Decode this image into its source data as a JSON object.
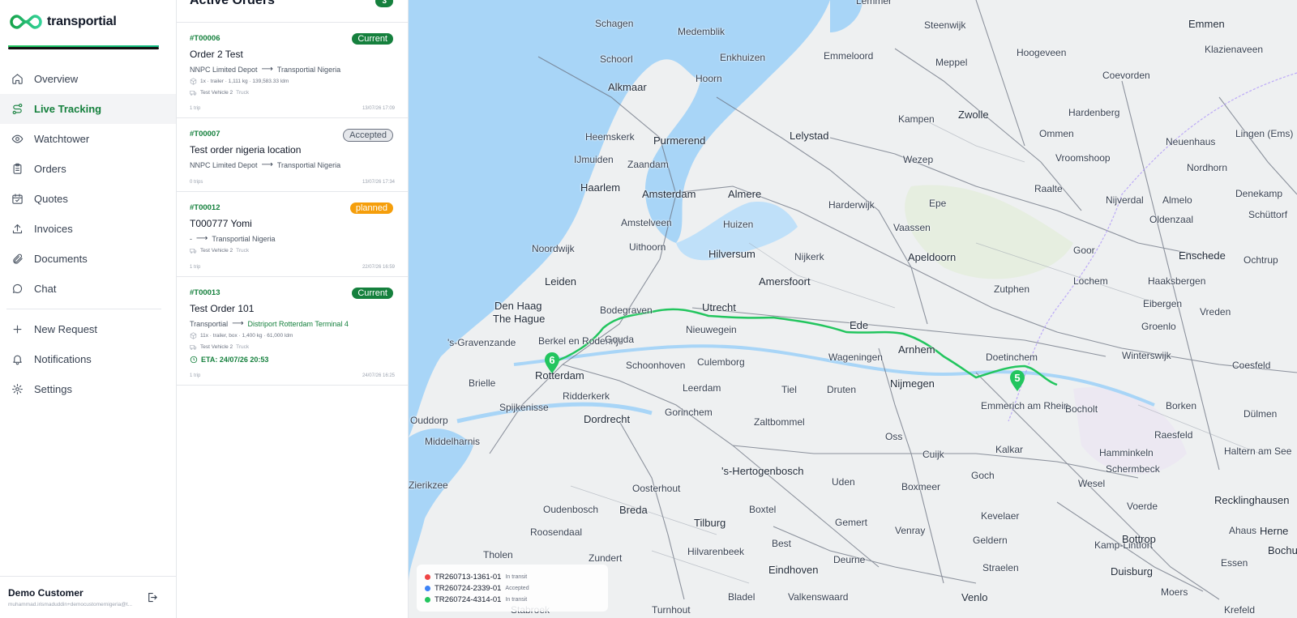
{
  "brand": {
    "name": "transportial",
    "accent": "#15803d"
  },
  "nav": {
    "items": [
      {
        "label": "Overview",
        "icon": "home-icon",
        "active": false
      },
      {
        "label": "Live Tracking",
        "icon": "route-icon",
        "active": true
      },
      {
        "label": "Watchtower",
        "icon": "eye-icon",
        "active": false
      },
      {
        "label": "Orders",
        "icon": "clipboard-icon",
        "active": false
      },
      {
        "label": "Quotes",
        "icon": "calendar-check-icon",
        "active": false
      },
      {
        "label": "Invoices",
        "icon": "upload-icon",
        "active": false
      },
      {
        "label": "Documents",
        "icon": "paperclip-icon",
        "active": false
      },
      {
        "label": "Chat",
        "icon": "chat-bubble-icon",
        "active": false
      }
    ],
    "secondary": [
      {
        "label": "New Request",
        "icon": "plus-icon"
      },
      {
        "label": "Notifications",
        "icon": "bell-icon"
      },
      {
        "label": "Settings",
        "icon": "gear-icon"
      }
    ]
  },
  "user": {
    "name": "Demo Customer",
    "email": "muhammad.irismaduddin+democustomernigeria@t..."
  },
  "orders_panel": {
    "title": "Active Orders",
    "count": "3",
    "orders": [
      {
        "id": "#T00006",
        "status": "Current",
        "title": "Order 2 Test",
        "from": "NNPC Limited Depot",
        "to": "Transportial Nigeria",
        "load": "1x · trailer · 1,111 kg · 139,583.33 ldm",
        "vehicle": "Test Vehicle 2",
        "vehicle_type": "Truck",
        "trips": "1 trip",
        "date": "13/07/26 17:09"
      },
      {
        "id": "#T00007",
        "status": "Accepted",
        "title": "Test order nigeria location",
        "from": "NNPC Limited Depot",
        "to": "Transportial Nigeria",
        "trips": "0 trips",
        "date": "13/07/26 17:34"
      },
      {
        "id": "#T00012",
        "status": "planned",
        "title": "T000777 Yomi",
        "from": "-",
        "to": "Transportial Nigeria",
        "vehicle": "Test Vehicle 2",
        "vehicle_type": "Truck",
        "trips": "1 trip",
        "date": "22/07/26 16:59"
      },
      {
        "id": "#T00013",
        "status": "Current",
        "title": "Test Order 101",
        "from": "Transportial",
        "to": "Distriport Rotterdam Terminal 4",
        "load": "11x · trailer, box · 1,400 kg · 61,000 ldm",
        "vehicle": "Test Vehicle 2",
        "vehicle_type": "Truck",
        "eta": "ETA: 24/07/26 20:53",
        "trips": "1 trip",
        "date": "24/07/26 16:25"
      }
    ]
  },
  "map": {
    "places": [
      "Schagen",
      "Medemblik",
      "Enkhuizen",
      "Emmeloord",
      "Steenwijk",
      "Meppel",
      "Hoogeveen",
      "Emmen",
      "Klazienaveen",
      "Lemmer",
      "Schoorl",
      "Hoorn",
      "Alkmaar",
      "Coevorden",
      "Heemskerk",
      "Purmerend",
      "Lelystad",
      "Kampen",
      "Zwolle",
      "Ommen",
      "Hardenberg",
      "Neuenhaus",
      "Nordhorn",
      "Lingen (Ems)",
      "IJmuiden",
      "Zaandam",
      "Wezep",
      "Vroomshoop",
      "Haarlem",
      "Amsterdam",
      "Almere",
      "Harderwijk",
      "Epe",
      "Raalte",
      "Nijverdal",
      "Almelo",
      "Denekamp",
      "Amstelveen",
      "Huizen",
      "Vaassen",
      "Oldenzaal",
      "Schüttorf",
      "Noordwijk",
      "Uithoorn",
      "Hilversum",
      "Apeldoorn",
      "Goor",
      "Enschede",
      "Ochtrup",
      "Nijkerk",
      "Leiden",
      "Amersfoort",
      "Lochem",
      "Haaksbergen",
      "Zutphen",
      "Den Haag",
      "The Hague",
      "Bodegraven",
      "Utrecht",
      "Eibergen",
      "Vreden",
      "'s-Gravenzande",
      "Berkel en Rodenrijs",
      "Gouda",
      "Nieuwegein",
      "Ede",
      "Groenlo",
      "Arnhem",
      "Doetinchem",
      "Winterswijk",
      "Wageningen",
      "Coesfeld",
      "Schoonhoven",
      "Culemborg",
      "Rotterdam",
      "Brielle",
      "Leerdam",
      "Tiel",
      "Druten",
      "Nijmegen",
      "Emmerich am Rhein",
      "Bocholt",
      "Borken",
      "Dülmen",
      "Spijkenisse",
      "Ridderkerk",
      "Gorinchem",
      "Zaltbommel",
      "Dordrecht",
      "Oss",
      "Raesfeld",
      "Ouddorp",
      "Middelharnis",
      "Cuijk",
      "Kalkar",
      "Hamminkeln",
      "Haltern am See",
      "'s-Hertogenbosch",
      "Schermbeck",
      "Zierikzee",
      "Oosterhout",
      "Uden",
      "Goch",
      "Boxmeer",
      "Wesel",
      "Recklinghausen",
      "Oudenbosch",
      "Breda",
      "Tilburg",
      "Boxtel",
      "Voerde",
      "Kevelaer",
      "Venray",
      "Ahaus",
      "Gemert",
      "Herne",
      "Tholen",
      "Roosendaal",
      "Geldern",
      "Kamp-Lintfort",
      "Bottrop",
      "Bochum",
      "Essen",
      "Zundert",
      "Hilvarenbeek",
      "Best",
      "Deurne",
      "Straelen",
      "Duisburg",
      "Eindhoven",
      "Bladel",
      "Valkenswaard",
      "Venlo",
      "Moers",
      "Krefeld",
      "Turnhout",
      "Stabroek"
    ],
    "markers": [
      {
        "label": "6",
        "color": "#22c55e"
      },
      {
        "label": "5",
        "color": "#22c55e"
      }
    ],
    "route_color": "#22c55e",
    "legend": [
      {
        "trip": "TR260713-1361-01",
        "status": "In transit",
        "color": "#ef4444"
      },
      {
        "trip": "TR260724-2339-01",
        "status": "Accepted",
        "color": "#3b82f6"
      },
      {
        "trip": "TR260724-4314-01",
        "status": "In transit",
        "color": "#22c55e"
      }
    ]
  }
}
